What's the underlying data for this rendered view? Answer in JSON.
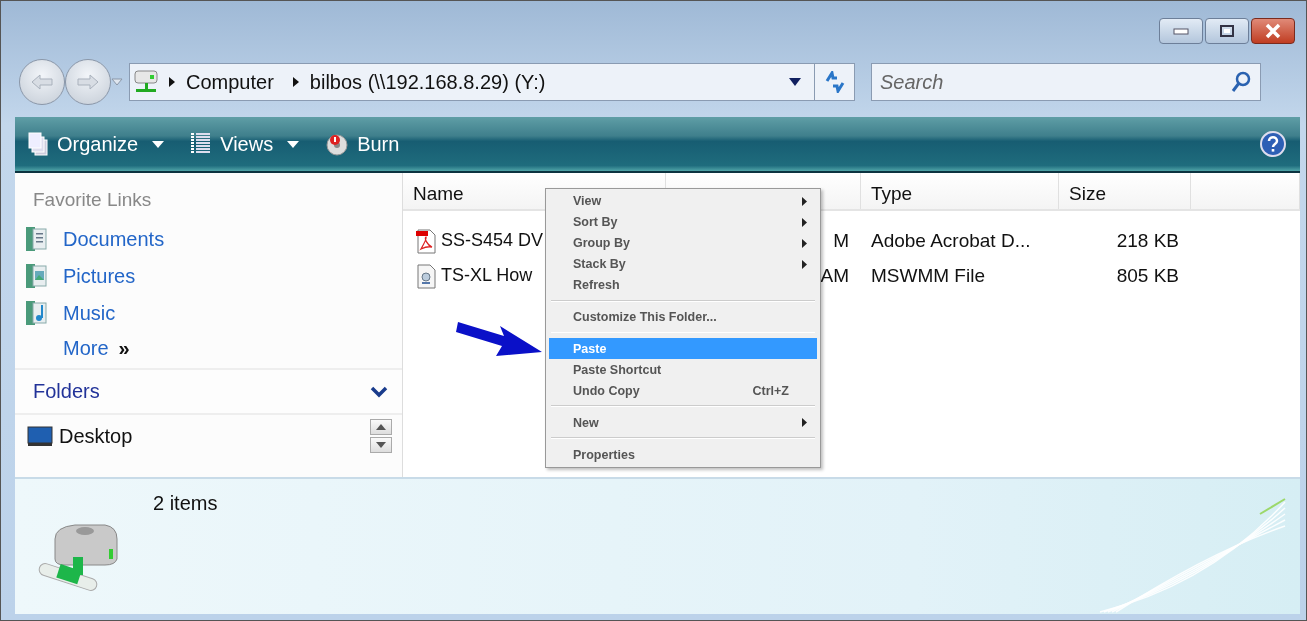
{
  "address": {
    "crumbs": [
      "Computer",
      "bilbos (\\\\192.168.8.29) (Y:)"
    ]
  },
  "search": {
    "placeholder": "Search"
  },
  "toolbar": {
    "items": [
      {
        "label": "Organize",
        "kind": "pages",
        "dropdown": true
      },
      {
        "label": "Views",
        "kind": "views",
        "dropdown": true
      },
      {
        "label": "Burn",
        "kind": "disc",
        "dropdown": false
      }
    ]
  },
  "sidebar": {
    "favorites_title": "Favorite Links",
    "links": [
      {
        "label": "Documents",
        "kind": "documents"
      },
      {
        "label": "Pictures",
        "kind": "pictures"
      },
      {
        "label": "Music",
        "kind": "music"
      }
    ],
    "more": {
      "label": "More",
      "glyph": "»"
    },
    "folders_title": "Folders",
    "tree": [
      {
        "label": "Desktop"
      }
    ]
  },
  "table": {
    "columns": [
      "Name",
      "",
      "Type",
      "Size"
    ],
    "rows": [
      {
        "name": "SS-S454 DV",
        "kind": "pdf",
        "column_2": "M",
        "type": "Adobe Acrobat D...",
        "size": "218 KB"
      },
      {
        "name": "TS-XL How",
        "kind": "movie",
        "column_2": "AM",
        "type": "MSWMM File",
        "size": "805 KB"
      }
    ]
  },
  "context_menu": {
    "items": [
      {
        "kind": "item",
        "label": "View",
        "submenu": true,
        "selected": false
      },
      {
        "kind": "item",
        "label": "Sort By",
        "submenu": true,
        "selected": false
      },
      {
        "kind": "item",
        "label": "Group By",
        "submenu": true,
        "selected": false
      },
      {
        "kind": "item",
        "label": "Stack By",
        "submenu": true,
        "selected": false
      },
      {
        "kind": "item",
        "label": "Refresh",
        "submenu": false,
        "selected": false
      },
      {
        "kind": "separator"
      },
      {
        "kind": "item",
        "label": "Customize This Folder...",
        "submenu": false,
        "selected": false
      },
      {
        "kind": "separator"
      },
      {
        "kind": "item",
        "label": "Paste",
        "submenu": false,
        "selected": true
      },
      {
        "kind": "item",
        "label": "Paste Shortcut",
        "submenu": false,
        "selected": false
      },
      {
        "kind": "item",
        "label": "Undo Copy",
        "shortcut": "Ctrl+Z",
        "submenu": false,
        "selected": false
      },
      {
        "kind": "separator"
      },
      {
        "kind": "item",
        "label": "New",
        "submenu": true,
        "selected": false
      },
      {
        "kind": "separator"
      },
      {
        "kind": "item",
        "label": "Properties",
        "submenu": false,
        "selected": false
      }
    ]
  },
  "details": {
    "count": "2 items"
  }
}
